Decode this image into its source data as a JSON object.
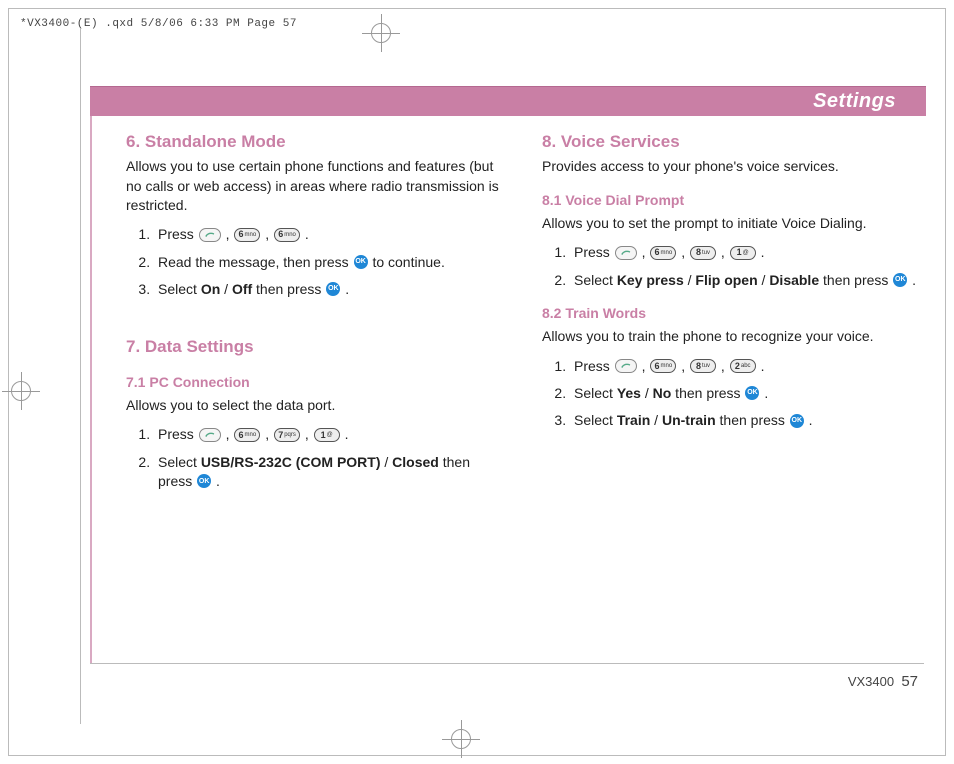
{
  "meta": {
    "header_line": "*VX3400-(E) .qxd  5/8/06  6:33 PM  Page 57"
  },
  "titlebar": {
    "text": "Settings"
  },
  "footer": {
    "model": "VX3400",
    "page": "57"
  },
  "keys": {
    "ok": "OK"
  },
  "colL": {
    "sec6": {
      "title": "6. Standalone Mode",
      "desc": "Allows you to use certain phone functions and features (but no calls or web access) in areas where radio transmission is restricted.",
      "s1a": "Press ",
      "s1b": " .",
      "s2a": "Read the message, then press ",
      "s2b": " to continue.",
      "s3a": "Select ",
      "s3b": "On",
      "s3c": " / ",
      "s3d": "Off",
      "s3e": " then press ",
      "s3f": " ."
    },
    "sec7": {
      "title": "7. Data Settings",
      "sub1": "7.1 PC Connection",
      "p1": "Allows you to select the data port.",
      "s1a": "Press ",
      "s1b": " .",
      "s2a": "Select ",
      "s2b": "USB/RS-232C (COM PORT)",
      "s2c": " / ",
      "s2d": "Closed",
      "s2e": " then press ",
      "s2f": " ."
    }
  },
  "colR": {
    "sec8": {
      "title": "8. Voice Services",
      "desc": "Provides access to your phone's voice services.",
      "sub1": "8.1 Voice Dial Prompt",
      "p1": "Allows you to set the prompt to initiate Voice Dialing.",
      "s1a": "Press ",
      "s1b": " .",
      "s2a": "Select ",
      "s2b": "Key press",
      "s2c": " / ",
      "s2d": "Flip open",
      "s2e": " / ",
      "s2f": "Disable",
      "s2g": " then press ",
      "s2h": " .",
      "sub2": "8.2 Train Words",
      "p2": "Allows you to train the phone to recognize your voice.",
      "t1a": "Press ",
      "t1b": " .",
      "t2a": "Select ",
      "t2b": "Yes",
      "t2c": " / ",
      "t2d": "No",
      "t2e": " then press ",
      "t2f": " .",
      "t3a": "Select ",
      "t3b": "Train",
      "t3c": " / ",
      "t3d": "Un-train",
      "t3e": " then press ",
      "t3f": " ."
    }
  }
}
